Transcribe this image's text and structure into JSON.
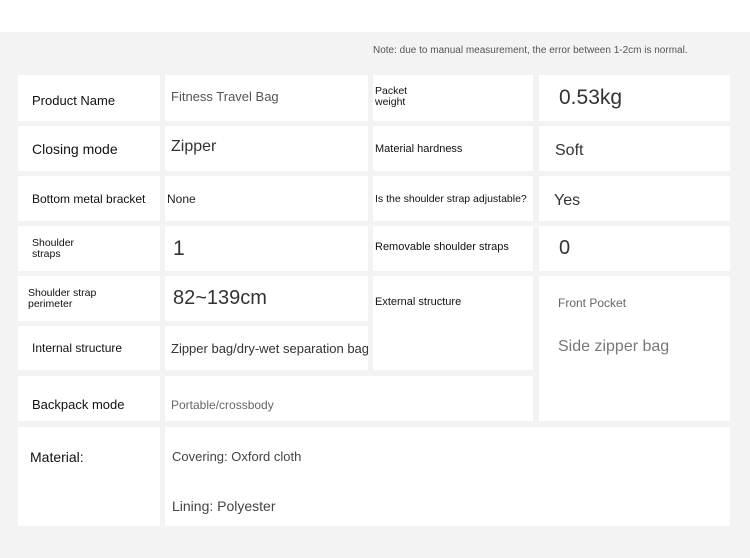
{
  "note": "Note: due to manual measurement, the error between 1-2cm is normal.",
  "rows": {
    "product_name": {
      "label": "Product Name",
      "value": "Fitness Travel Bag"
    },
    "packet_weight": {
      "label_line1": "Packet",
      "label_line2": "weight",
      "value": "0.53kg"
    },
    "closing_mode": {
      "label": "Closing mode",
      "value": "Zipper"
    },
    "material_hardness": {
      "label": "Material hardness",
      "value": "Soft"
    },
    "bottom_bracket": {
      "label": "Bottom metal bracket",
      "value": "None"
    },
    "strap_adjustable": {
      "label": "Is the shoulder strap adjustable?",
      "value": "Yes"
    },
    "shoulder_straps": {
      "label_line1": "Shoulder",
      "label_line2": "straps",
      "value": "1"
    },
    "removable_straps": {
      "label": "Removable shoulder straps",
      "value": "0"
    },
    "strap_perimeter": {
      "label_line1": "Shoulder strap",
      "label_line2": "perimeter",
      "value": "82~139cm"
    },
    "external_structure": {
      "label": "External structure",
      "value_1": "Front Pocket",
      "value_2": "Side zipper bag"
    },
    "internal_structure": {
      "label": "Internal structure",
      "value": "Zipper bag/dry-wet separation bag"
    },
    "backpack_mode": {
      "label": "Backpack mode",
      "value": "Portable/crossbody"
    },
    "material": {
      "label": "Material:",
      "covering": "Covering: Oxford cloth",
      "lining": "Lining: Polyester"
    }
  }
}
